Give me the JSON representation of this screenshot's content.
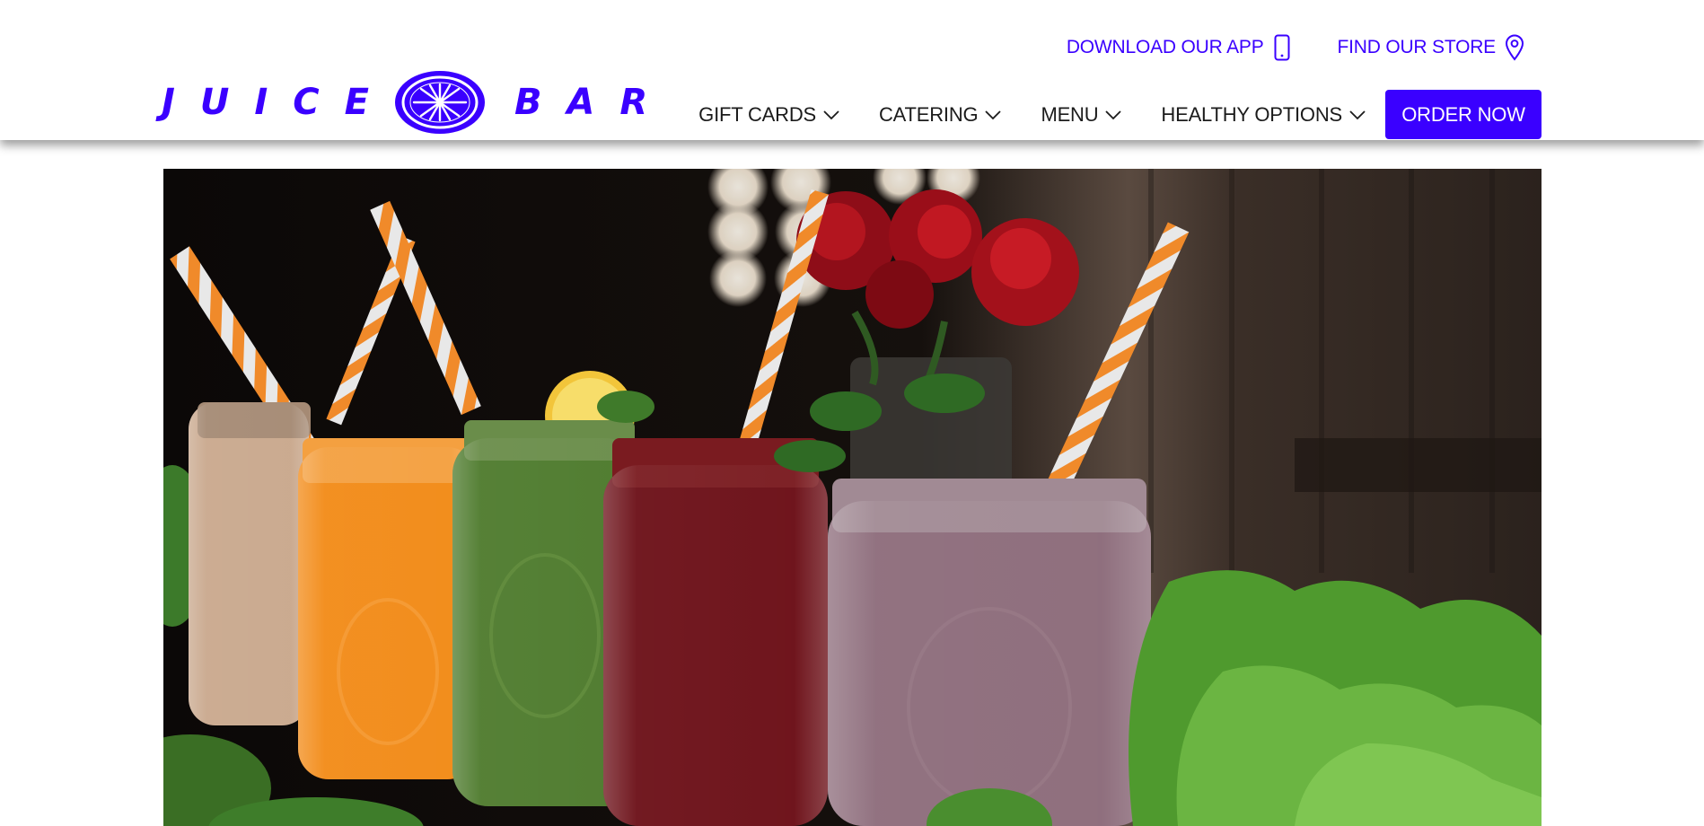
{
  "header": {
    "logo": {
      "word_left": "JUICE",
      "word_right": "BAR",
      "mark": "citrus-slice-icon"
    },
    "utility_links": [
      {
        "label": "DOWNLOAD OUR APP",
        "icon": "smartphone-icon"
      },
      {
        "label": "FIND OUR STORE",
        "icon": "map-pin-icon"
      }
    ],
    "nav": [
      {
        "label": "GIFT CARDS",
        "icon": "chevron-down-icon"
      },
      {
        "label": "CATERING",
        "icon": "chevron-down-icon"
      },
      {
        "label": "MENU",
        "icon": "chevron-down-icon"
      },
      {
        "label": "HEALTHY OPTIONS",
        "icon": "chevron-down-icon"
      }
    ],
    "cta_label": "ORDER NOW"
  },
  "hero": {
    "subject": "row of smoothie jars with striped straws"
  },
  "colors": {
    "accent": "#3a00ff",
    "nav_text": "#1b1b1b",
    "background": "#ffffff"
  }
}
